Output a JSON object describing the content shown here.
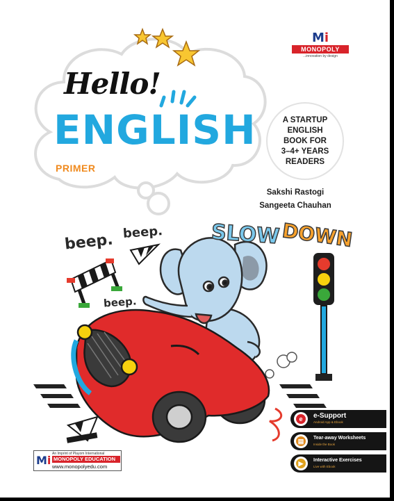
{
  "cover": {
    "hello": "Hello!",
    "title": "ENGLISH",
    "level": "PRIMER"
  },
  "publisher_logo": {
    "name": "MONOPOLY",
    "tagline": "...innovation by design"
  },
  "badge": {
    "text": "A STARTUP\nENGLISH\nBOOK FOR\n3–4+ YEARS\nREADERS"
  },
  "authors": [
    "Sakshi Rastogi",
    "Sangeeta Chauhan"
  ],
  "illustration": {
    "sign_words": [
      "SLOW",
      "DOWN"
    ],
    "beeps": [
      "beep.",
      "beep.",
      "beep."
    ]
  },
  "imprint": {
    "line1": "An Imprint of Playom International",
    "name": "MONOPOLY EDUCATION",
    "website": "www.monopolyedu.com"
  },
  "features": [
    {
      "title": "e-Support",
      "subtitle": "Android App & Ebook",
      "icon": "e-icon"
    },
    {
      "title": "Tear-away Worksheets",
      "subtitle": "Inside the Book",
      "icon": "worksheet-icon"
    },
    {
      "title": "Interactive Exercises",
      "subtitle": "Live with Ebook",
      "icon": "play-icon"
    }
  ],
  "colors": {
    "title_blue": "#22a8df",
    "primer_orange": "#f08a1e",
    "brand_red": "#d8232a",
    "car_red": "#e02b2b",
    "elephant_blue": "#bcd9ee",
    "feature_bar": "#151515"
  }
}
